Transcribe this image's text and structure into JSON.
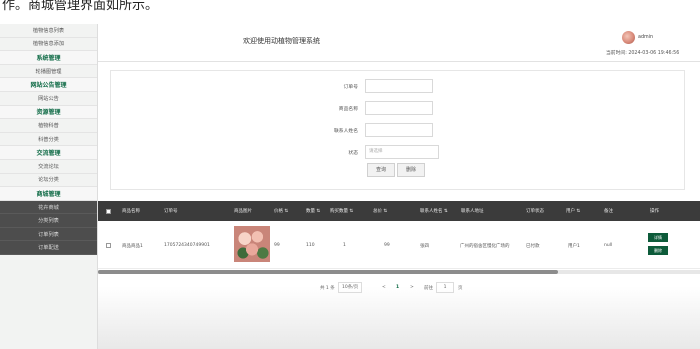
{
  "caption": "作。商城管理界面如所示。",
  "sidebar": {
    "items": [
      {
        "label": "植物信息列表",
        "type": "item"
      },
      {
        "label": "植物信息添加",
        "type": "item"
      },
      {
        "label": "系统管理",
        "type": "group"
      },
      {
        "label": "轮播图管理",
        "type": "item"
      },
      {
        "label": "网站公告管理",
        "type": "group"
      },
      {
        "label": "网站公告",
        "type": "item"
      },
      {
        "label": "资源管理",
        "type": "group"
      },
      {
        "label": "植物科普",
        "type": "item"
      },
      {
        "label": "科普分类",
        "type": "item"
      },
      {
        "label": "交流管理",
        "type": "group"
      },
      {
        "label": "交流论坛",
        "type": "item"
      },
      {
        "label": "论坛分类",
        "type": "item"
      },
      {
        "label": "商城管理",
        "type": "group"
      },
      {
        "label": "花卉商城",
        "type": "dark"
      },
      {
        "label": "分类列表",
        "type": "dark"
      },
      {
        "label": "订单列表",
        "type": "dark"
      },
      {
        "label": "订单配送",
        "type": "dark"
      }
    ]
  },
  "header": {
    "title": "欢迎使用动植物管理系统",
    "username": "admin",
    "time": "当前时间: 2024-03-06 19:46:56"
  },
  "filter": {
    "fields": [
      {
        "label": "订单号",
        "placeholder": ""
      },
      {
        "label": "商品名称",
        "placeholder": ""
      },
      {
        "label": "联系人姓名",
        "placeholder": ""
      },
      {
        "label": "状态",
        "placeholder": "请选择"
      }
    ],
    "query_label": "查询",
    "delete_label": "删除"
  },
  "table": {
    "headers": [
      "商品名称",
      "订单号",
      "商品图片",
      "价格 ⇅",
      "数量 ⇅",
      "购买数量 ⇅",
      "总价 ⇅",
      "联系人姓名 ⇅",
      "联系人地址",
      "订单状态",
      "用户 ⇅",
      "备注",
      "操作"
    ],
    "rows": [
      {
        "cells": [
          "商品商品1",
          "1705724340749901",
          "",
          "99",
          "110",
          "1",
          "99",
          "张四",
          "广州的宿舍区慢化广场的",
          "已付款",
          "用户1",
          "null"
        ],
        "actions": [
          "详情",
          "删除"
        ]
      }
    ]
  },
  "pager": {
    "total": "共 1 条",
    "page_size": "10条/页",
    "prev": "<",
    "page": "1",
    "next": ">",
    "goto_label": "前往",
    "goto_value": "1",
    "page_suffix": "页"
  }
}
